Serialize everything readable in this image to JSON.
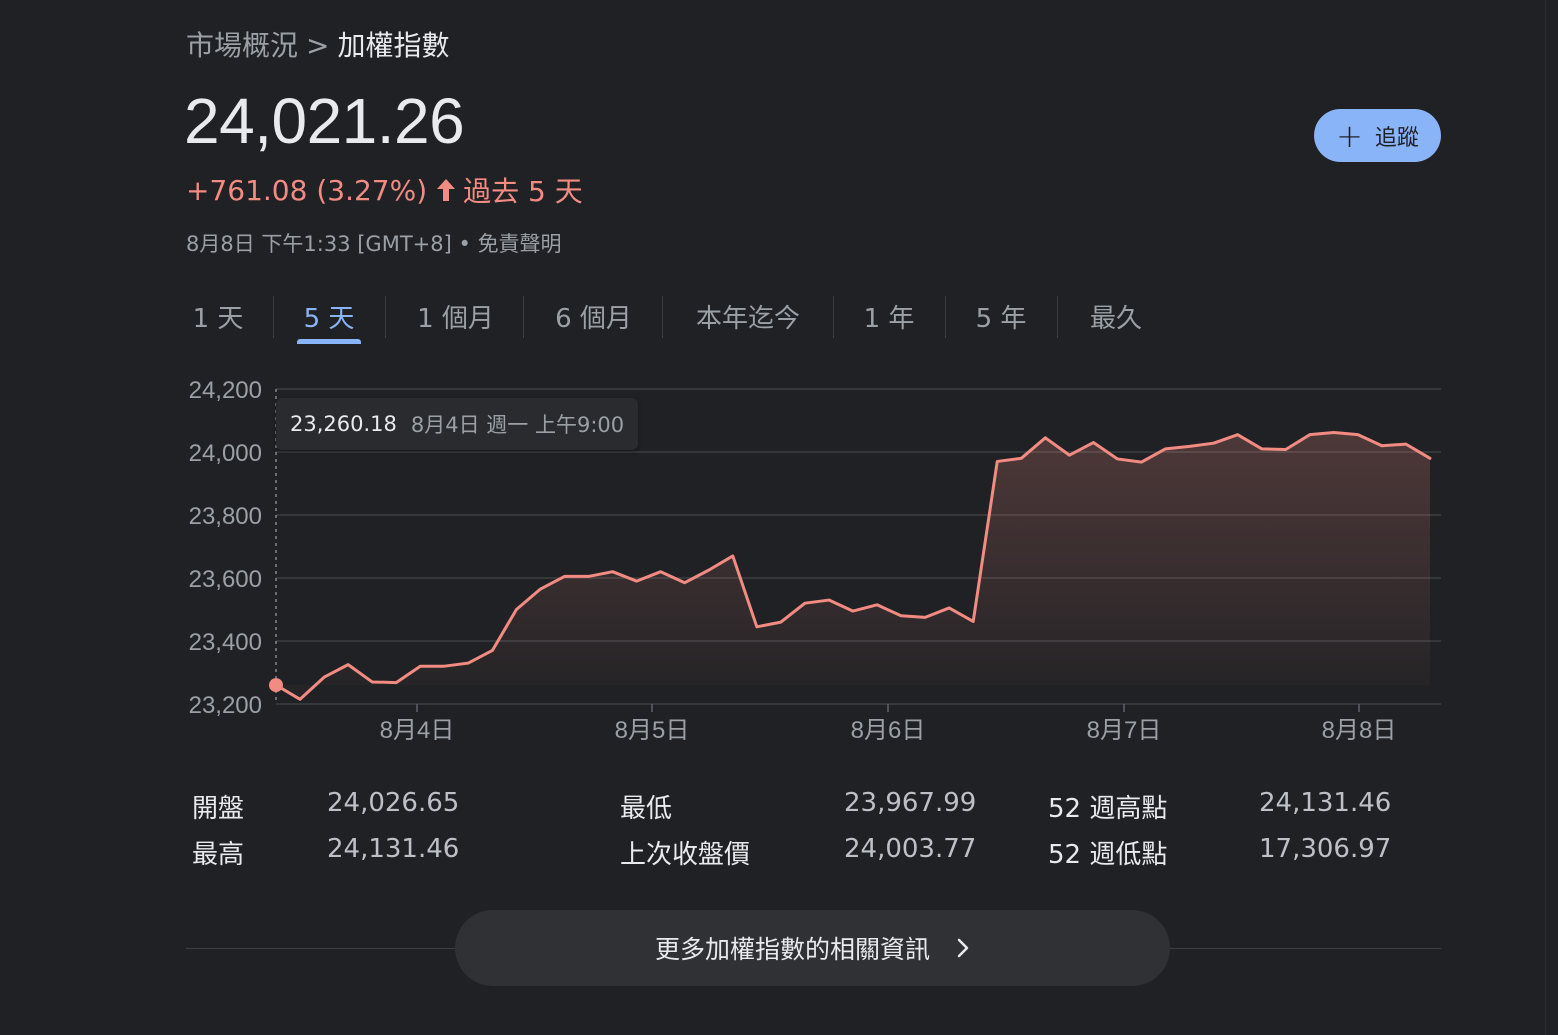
{
  "breadcrumb": {
    "parent": "市場概況",
    "separator": ">",
    "current": "加權指數"
  },
  "quote": {
    "price": "24,021.26",
    "change": "+761.08 (3.27%)",
    "period": "過去 5 天",
    "timestamp": "8月8日 下午1:33 [GMT+8]",
    "bullet": "•",
    "disclaimer": "免責聲明"
  },
  "follow_button": {
    "label": "追蹤",
    "icon": "plus-icon"
  },
  "range_tabs": [
    {
      "label": "1 天",
      "active": false
    },
    {
      "label": "5 天",
      "active": true
    },
    {
      "label": "1 個月",
      "active": false
    },
    {
      "label": "6 個月",
      "active": false
    },
    {
      "label": "本年迄今",
      "active": false
    },
    {
      "label": "1 年",
      "active": false
    },
    {
      "label": "5 年",
      "active": false
    },
    {
      "label": "最久",
      "active": false
    }
  ],
  "tooltip": {
    "value": "23,260.18",
    "time": "8月4日 週一 上午9:00"
  },
  "chart_data": {
    "type": "line",
    "x_tick_labels": [
      "8月4日",
      "8月5日",
      "8月6日",
      "8月7日",
      "8月8日"
    ],
    "y_tick_labels": [
      "24,200",
      "24,000",
      "23,800",
      "23,600",
      "23,400",
      "23,200"
    ],
    "ylim": [
      23200,
      24200
    ],
    "grid": true,
    "area_fill": true,
    "line_color": "#f28b82",
    "series": [
      {
        "values": [
          23260,
          23215,
          23285,
          23325,
          23270,
          23268,
          23320,
          23320,
          23330,
          23370,
          23500,
          23565,
          23605,
          23605,
          23620,
          23590,
          23620,
          23585,
          23625,
          23670,
          23445,
          23460,
          23520,
          23530,
          23495,
          23515,
          23480,
          23475,
          23505,
          23462,
          23970,
          23980,
          24045,
          23990,
          24030,
          23978,
          23968,
          24010,
          24018,
          24028,
          24055,
          24010,
          24008,
          24055,
          24062,
          24055,
          24020,
          24025,
          23980
        ]
      }
    ]
  },
  "stats": [
    {
      "label": "開盤",
      "value": "24,026.65"
    },
    {
      "label": "最高",
      "value": "24,131.46"
    },
    {
      "label": "最低",
      "value": "23,967.99"
    },
    {
      "label": "上次收盤價",
      "value": "24,003.77"
    },
    {
      "label": "52 週高點",
      "value": "24,131.46"
    },
    {
      "label": "52 週低點",
      "value": "17,306.97"
    }
  ],
  "more_button": {
    "label": "更多加權指數的相關資訊",
    "icon": "chevron-right-icon"
  },
  "colors": {
    "background": "#202124",
    "up": "#f28b82",
    "accent": "#8ab4f8"
  }
}
